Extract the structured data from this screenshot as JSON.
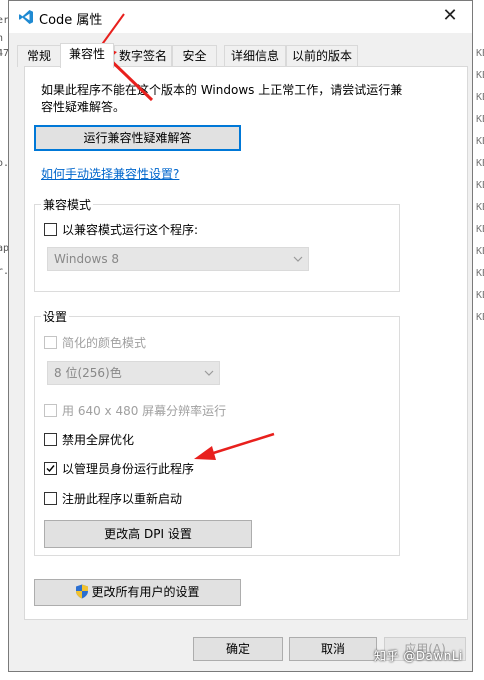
{
  "window": {
    "title": "Code 属性",
    "close_glyph": "✕"
  },
  "tabs": [
    {
      "label": "常规"
    },
    {
      "label": "兼容性"
    },
    {
      "label": "数字签名"
    },
    {
      "label": "安全"
    },
    {
      "label": "详细信息"
    },
    {
      "label": "以前的版本"
    }
  ],
  "compat": {
    "intro_line1": "如果此程序不能在这个版本的 Windows 上正常工作，请尝试运行兼",
    "intro_line2": "容性疑难解答。",
    "troubleshoot_button": "运行兼容性疑难解答",
    "manual_link": "如何手动选择兼容性设置?",
    "mode_group_title": "兼容模式",
    "mode_checkbox": "以兼容模式运行这个程序:",
    "mode_select": "Windows 8",
    "settings_group_title": "设置",
    "reduced_color": "简化的颜色模式",
    "color_select": "8 位(256)色",
    "res_640": "用 640 x 480 屏幕分辨率运行",
    "disable_fullscreen": "禁用全屏优化",
    "run_as_admin": "以管理员身份运行此程序",
    "register_restart": "注册此程序以重新启动",
    "change_dpi_button": "更改高 DPI 设置",
    "change_all_users_button": "更改所有用户的设置"
  },
  "footer": {
    "ok": "确定",
    "cancel": "取消",
    "apply": "应用(A)"
  },
  "watermark": "知乎 @DawnLi",
  "checkbox_states": {
    "run_as_admin": true,
    "disable_fullscreen": false,
    "register_restart": false,
    "mode_checkbox": false
  },
  "colors": {
    "annotation_arrow": "#e8201d",
    "link": "#0066cc",
    "focus_border": "#0078d7"
  },
  "icons": [
    "vscode-app-icon",
    "close-icon",
    "chevron-down-icon",
    "uac-shield-icon",
    "annotation-arrow-icon"
  ]
}
